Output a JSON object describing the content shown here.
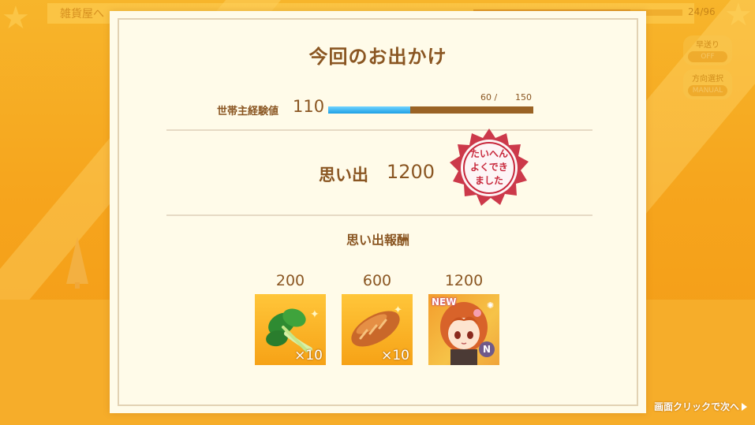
{
  "background": {
    "top_title": "雑貨屋へ",
    "progress_text": "24/96",
    "progress_fraction": 0.75,
    "auto_label": "早送り",
    "auto_value": "OFF",
    "mode_label": "方向選択",
    "mode_value": "MANUAL"
  },
  "dialog": {
    "title": "今回のお出かけ",
    "experience": {
      "label": "世帯主経験値",
      "value": "110",
      "current": "60 /",
      "max": "150",
      "fill_fraction": 0.4
    },
    "memory": {
      "label": "思い出",
      "value": "1200"
    },
    "stamp": {
      "text_line1": "たいへん",
      "text_line2": "よくでき",
      "text_line3": "ました"
    },
    "rewards_title": "思い出報酬",
    "rewards": [
      {
        "threshold": "200",
        "item": "greens-icon",
        "quantity": "×10"
      },
      {
        "threshold": "600",
        "item": "bread-icon",
        "quantity": "×10"
      },
      {
        "threshold": "1200",
        "item": "character-card",
        "badge": "NEW",
        "rarity": "N"
      }
    ]
  },
  "next_hint": "画面クリックで次へ",
  "colors": {
    "background": "#f3a21a",
    "dialog": "#fffbe9",
    "text_brown": "#8a5622",
    "bar_blue": "#1fa0e4",
    "stamp_red": "#c8283c"
  }
}
